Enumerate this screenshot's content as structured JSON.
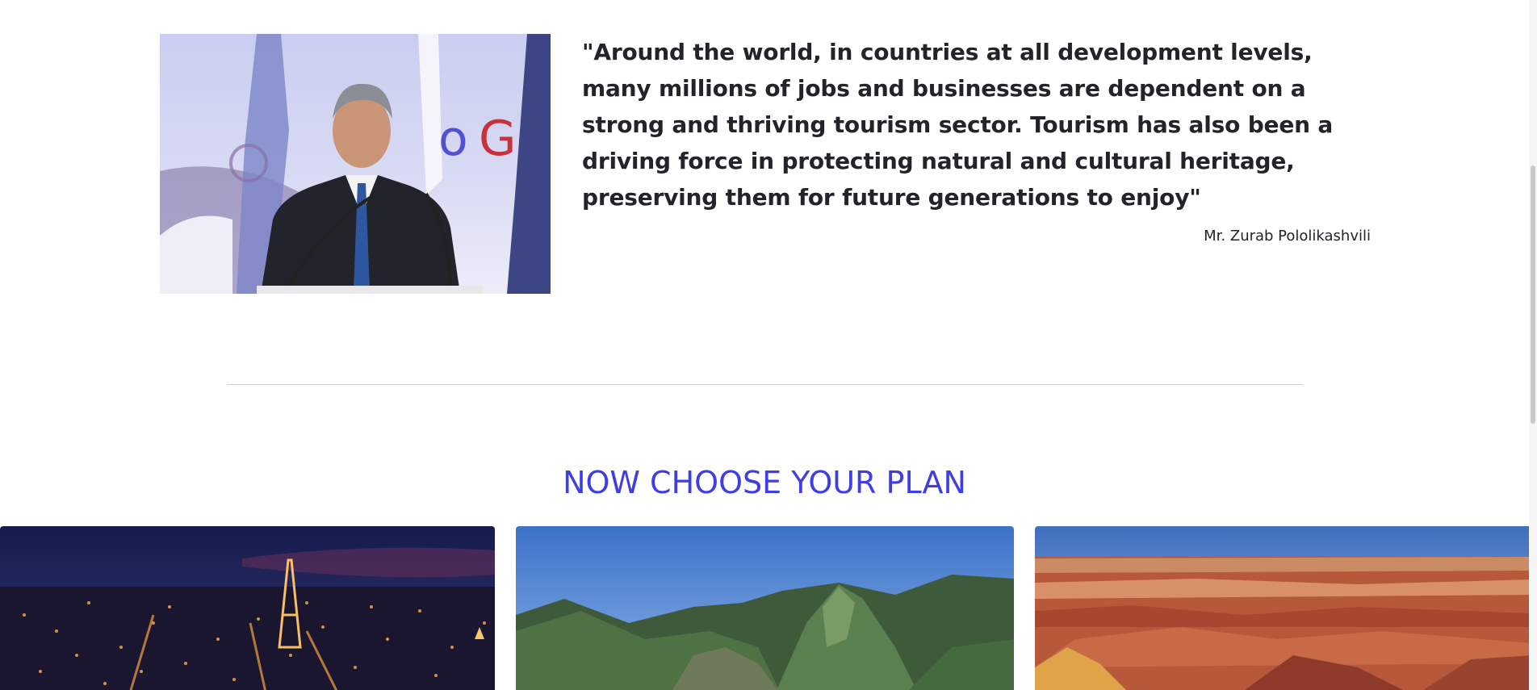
{
  "quote": {
    "text": "\"Around the world, in countries at all development levels, many millions of jobs and businesses are dependent on a strong and thriving tourism sector. Tourism has also been a driving force in protecting natural and cultural heritage, preserving them for future generations to enjoy\"",
    "author": "Mr. Zurab Pololikashvili"
  },
  "plans": {
    "title": "NOW CHOOSE YOUR PLAN",
    "cards": [
      {
        "image_icon": "paris-night-photo"
      },
      {
        "image_icon": "machu-picchu-photo"
      },
      {
        "image_icon": "grand-canyon-photo"
      }
    ]
  },
  "colors": {
    "plan_title": "#3e3ee4",
    "text": "#212529",
    "divider": "#cfcfcf"
  }
}
